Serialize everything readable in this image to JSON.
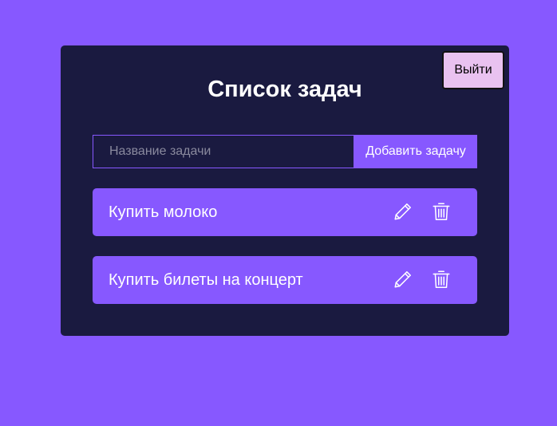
{
  "header": {
    "title": "Список задач",
    "logout_label": "Выйти"
  },
  "form": {
    "placeholder": "Название задачи",
    "value": "",
    "add_label": "Добавить задачу"
  },
  "tasks": [
    {
      "text": "Купить молоко",
      "icons": [
        "edit-icon",
        "trash-icon"
      ]
    },
    {
      "text": "Купить билеты на концерт",
      "icons": [
        "edit-icon",
        "trash-icon"
      ]
    }
  ],
  "colors": {
    "background": "#8758ff",
    "card": "#1a1a40",
    "accent": "#8758ff",
    "logout_button": "#e9c2f0"
  }
}
